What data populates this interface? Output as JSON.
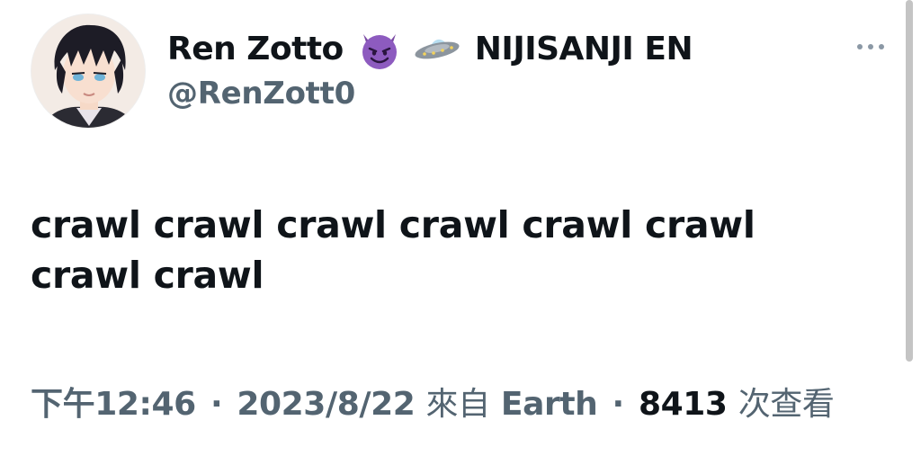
{
  "author": {
    "display_name": "Ren Zotto",
    "emoji_1": "smiling-imp-emoji",
    "emoji_2": "ufo-emoji",
    "affiliation": "NIJISANJI EN",
    "handle": "@RenZott0"
  },
  "tweet": {
    "text": "crawl crawl crawl crawl crawl crawl crawl crawl"
  },
  "meta": {
    "time": "下午12:46",
    "separator": "·",
    "date": "2023/8/22",
    "via_prefix": "來自",
    "source": "Earth",
    "views_count": "8413",
    "views_label": "次查看"
  },
  "colors": {
    "text_primary": "#0f1419",
    "text_secondary": "#536471",
    "background": "#ffffff"
  }
}
